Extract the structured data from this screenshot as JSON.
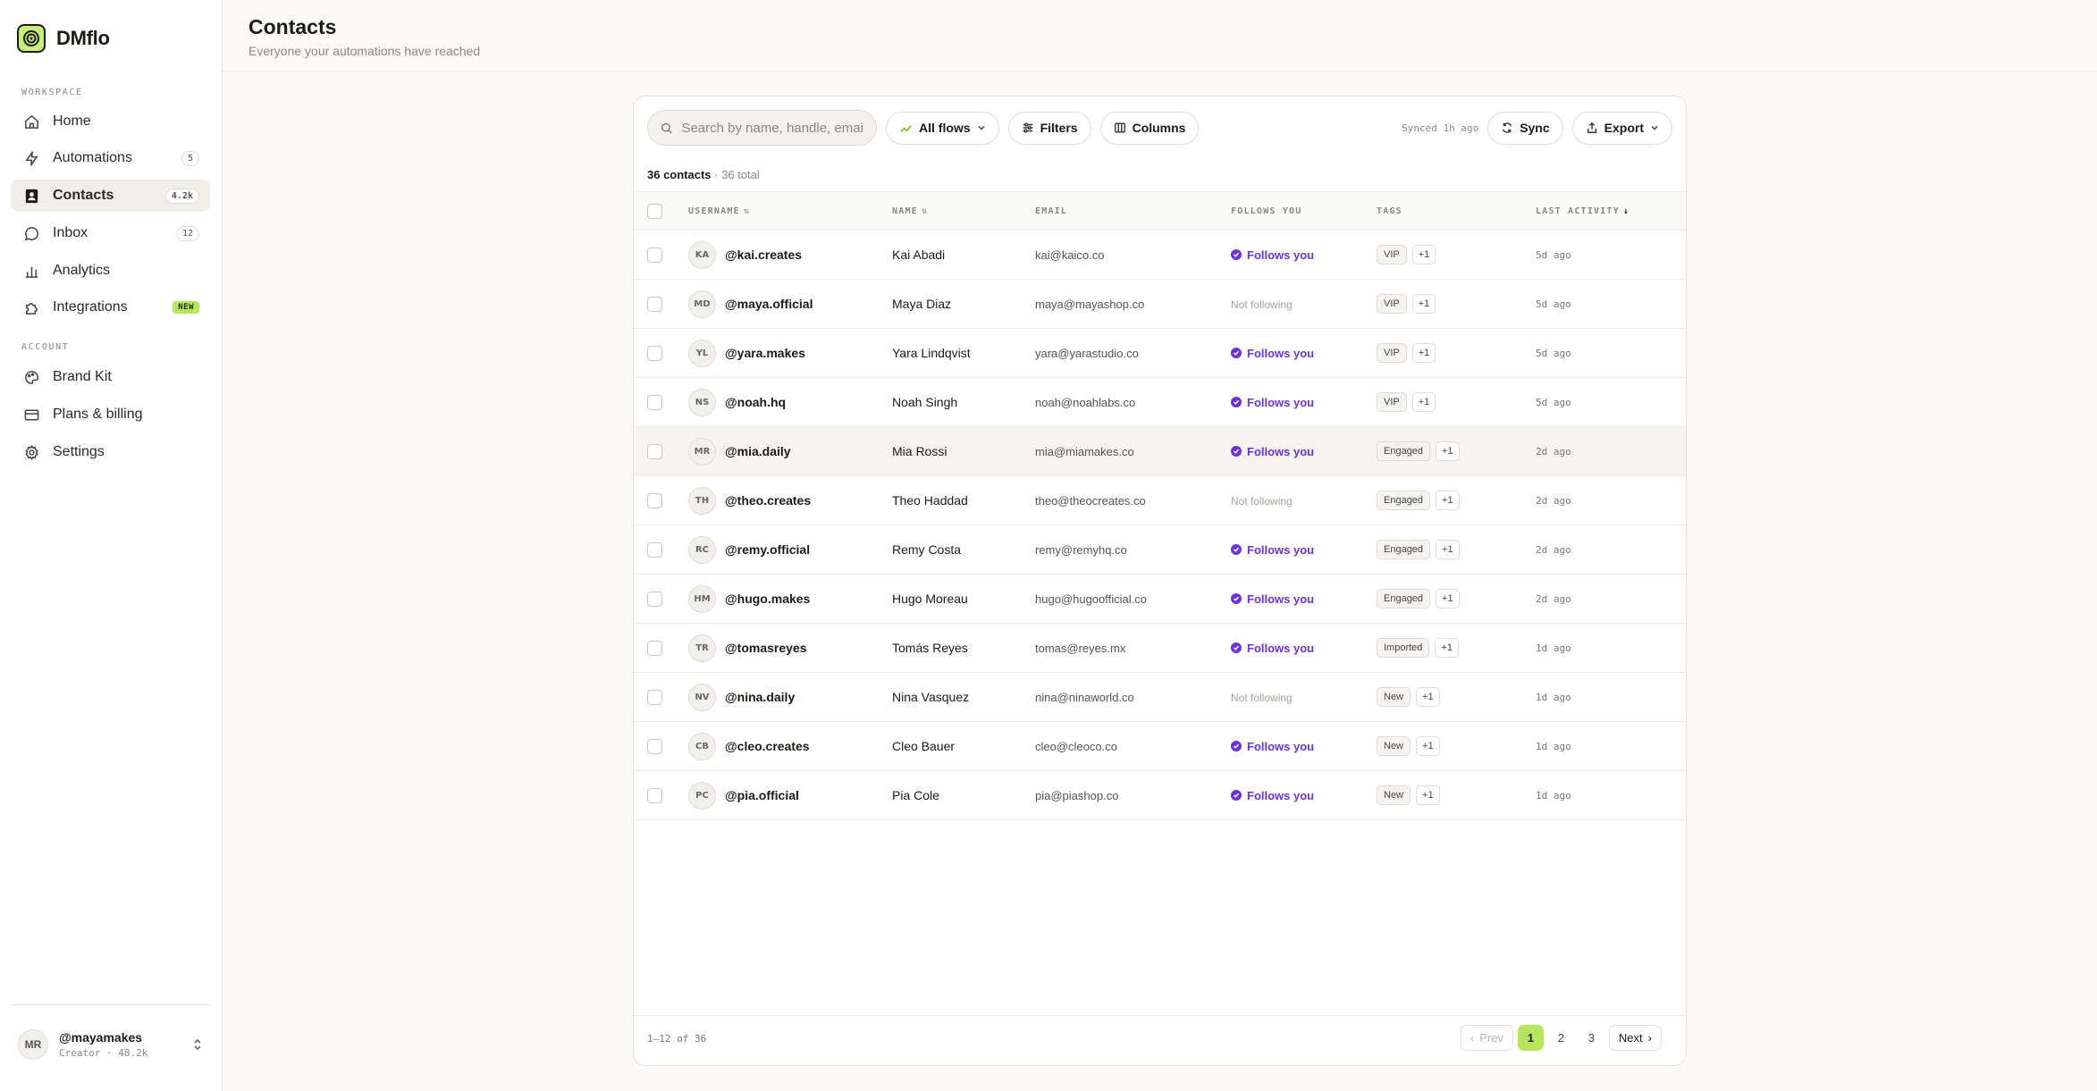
{
  "app": {
    "name": "DMflo",
    "accent": "#b6e65c",
    "purple": "#6b35d6"
  },
  "sidebar": {
    "workspace_label": "WORKSPACE",
    "account_label": "ACCOUNT",
    "items": [
      {
        "label": "Home",
        "icon": "home-icon"
      },
      {
        "label": "Automations",
        "icon": "bolt-icon",
        "count": "5"
      },
      {
        "label": "Contacts",
        "icon": "contacts-icon",
        "count": "4.2k",
        "active": true
      },
      {
        "label": "Inbox",
        "icon": "chat-icon",
        "count": "12"
      },
      {
        "label": "Analytics",
        "icon": "bar-chart-icon"
      },
      {
        "label": "Integrations",
        "icon": "puzzle-icon",
        "badge": "NEW"
      }
    ],
    "account_items": [
      {
        "label": "Brand Kit",
        "icon": "palette-icon"
      },
      {
        "label": "Plans & billing",
        "icon": "card-icon"
      },
      {
        "label": "Settings",
        "icon": "gear-icon"
      }
    ],
    "user": {
      "initials": "MR",
      "handle": "@mayamakes",
      "sub": "Creator · 48.2k"
    }
  },
  "header": {
    "title": "Contacts",
    "subtitle": "Everyone your automations have reached"
  },
  "toolbar": {
    "search_placeholder": "Search by name, handle, email, tag",
    "flows_label": "All flows",
    "filters_label": "Filters",
    "columns_label": "Columns",
    "synced": "Synced 1h ago",
    "sync_label": "Sync",
    "export_label": "Export"
  },
  "summary": {
    "shown": "36 contacts",
    "total": " · 36 total"
  },
  "table": {
    "columns": [
      "USERNAME",
      "NAME",
      "EMAIL",
      "FOLLOWS YOU",
      "TAGS",
      "LAST ACTIVITY"
    ],
    "rows": [
      {
        "initials": "KA",
        "handle": "@kai.creates",
        "name": "Kai Abadi",
        "email": "kai@kaico.co",
        "follows": true,
        "tag": "VIP",
        "more": "+1",
        "activity": "5d ago"
      },
      {
        "initials": "MD",
        "handle": "@maya.official",
        "name": "Maya Diaz",
        "email": "maya@mayashop.co",
        "follows": false,
        "tag": "VIP",
        "more": "+1",
        "activity": "5d ago"
      },
      {
        "initials": "YL",
        "handle": "@yara.makes",
        "name": "Yara Lindqvist",
        "email": "yara@yarastudio.co",
        "follows": true,
        "tag": "VIP",
        "more": "+1",
        "activity": "5d ago"
      },
      {
        "initials": "NS",
        "handle": "@noah.hq",
        "name": "Noah Singh",
        "email": "noah@noahlabs.co",
        "follows": true,
        "tag": "VIP",
        "more": "+1",
        "activity": "5d ago"
      },
      {
        "initials": "MR",
        "handle": "@mia.daily",
        "name": "Mia Rossi",
        "email": "mia@miamakes.co",
        "follows": true,
        "tag": "Engaged",
        "more": "+1",
        "activity": "2d ago",
        "hl": true
      },
      {
        "initials": "TH",
        "handle": "@theo.creates",
        "name": "Theo Haddad",
        "email": "theo@theocreates.co",
        "follows": false,
        "tag": "Engaged",
        "more": "+1",
        "activity": "2d ago"
      },
      {
        "initials": "RC",
        "handle": "@remy.official",
        "name": "Remy Costa",
        "email": "remy@remyhq.co",
        "follows": true,
        "tag": "Engaged",
        "more": "+1",
        "activity": "2d ago"
      },
      {
        "initials": "HM",
        "handle": "@hugo.makes",
        "name": "Hugo Moreau",
        "email": "hugo@hugoofficial.co",
        "follows": true,
        "tag": "Engaged",
        "more": "+1",
        "activity": "2d ago"
      },
      {
        "initials": "TR",
        "handle": "@tomasreyes",
        "name": "Tomás Reyes",
        "email": "tomas@reyes.mx",
        "follows": true,
        "tag": "Imported",
        "more": "+1",
        "activity": "1d ago"
      },
      {
        "initials": "NV",
        "handle": "@nina.daily",
        "name": "Nina Vasquez",
        "email": "nina@ninaworld.co",
        "follows": false,
        "tag": "New",
        "more": "+1",
        "activity": "1d ago"
      },
      {
        "initials": "CB",
        "handle": "@cleo.creates",
        "name": "Cleo Bauer",
        "email": "cleo@cleoco.co",
        "follows": true,
        "tag": "New",
        "more": "+1",
        "activity": "1d ago"
      },
      {
        "initials": "PC",
        "handle": "@pia.official",
        "name": "Pia Cole",
        "email": "pia@piashop.co",
        "follows": true,
        "tag": "New",
        "more": "+1",
        "activity": "1d ago"
      }
    ],
    "follows_label": "Follows you",
    "not_follow_label": "Not following"
  },
  "footer": {
    "range": "1–12 of 36",
    "prev": "Prev",
    "next": "Next",
    "pages": [
      "1",
      "2",
      "3"
    ],
    "current": "1"
  }
}
